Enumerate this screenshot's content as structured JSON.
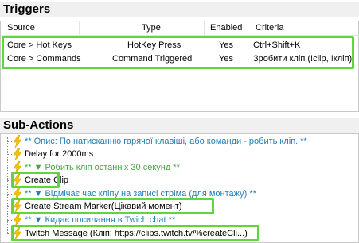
{
  "triggers": {
    "title": "Triggers",
    "columns": [
      "Source",
      "Type",
      "Enabled",
      "Criteria"
    ],
    "rows": [
      {
        "source": "Core > Hot Keys",
        "type": "HotKey Press",
        "enabled": "Yes",
        "criteria": "Ctrl+Shift+K"
      },
      {
        "source": "Core > Commands",
        "type": "Command Triggered",
        "enabled": "Yes",
        "criteria": "Зробити кліп (!clip, !кліп)"
      }
    ]
  },
  "subactions": {
    "title": "Sub-Actions",
    "items": [
      {
        "text": "** Опис: По натисканню гарячої клавіші, або команди - робить кліп. **",
        "kind": "comment"
      },
      {
        "text": "Delay for 2000ms",
        "kind": "action"
      },
      {
        "text": "** ▼ Робить кліп останніх 30 секунд **",
        "kind": "group"
      },
      {
        "text": "Create Clip",
        "kind": "action"
      },
      {
        "text": "** ▼ Відмічає час кліпу на записі стріма (для монтажу) **",
        "kind": "comment"
      },
      {
        "text": "Create Stream Marker(Цікавий момент)",
        "kind": "action"
      },
      {
        "text": "** ▼ Кидає посилання в Twich chat **",
        "kind": "comment"
      },
      {
        "text": "Twitch Message (Кліп: https://clips.twitch.tv/%createCli...)",
        "kind": "action"
      }
    ]
  },
  "colors": {
    "highlight": "#5fd63a",
    "comment": "#1f7fb5",
    "group": "#4aa24a",
    "bolt": "#f2c200"
  }
}
